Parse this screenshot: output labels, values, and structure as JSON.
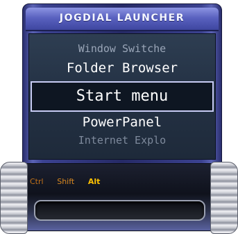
{
  "window": {
    "title": "JOGDIAL LAUNCHER"
  },
  "menu": {
    "items": [
      {
        "label": "Window Switche"
      },
      {
        "label": "Folder Browser"
      },
      {
        "label": "Start menu"
      },
      {
        "label": "PowerPanel"
      },
      {
        "label": "Internet Explo"
      }
    ],
    "selected": "Start menu"
  },
  "modifiers": [
    {
      "label": "Ctrl"
    },
    {
      "label": "Shift"
    },
    {
      "label": "Alt"
    }
  ],
  "colors": {
    "title_bar": "#5a62c0",
    "panel": "#253346",
    "modifier_active": "#ffc200",
    "modifier_inactive": "#c07018"
  },
  "icons": [
    "jog-dial-left",
    "jog-dial-right"
  ]
}
